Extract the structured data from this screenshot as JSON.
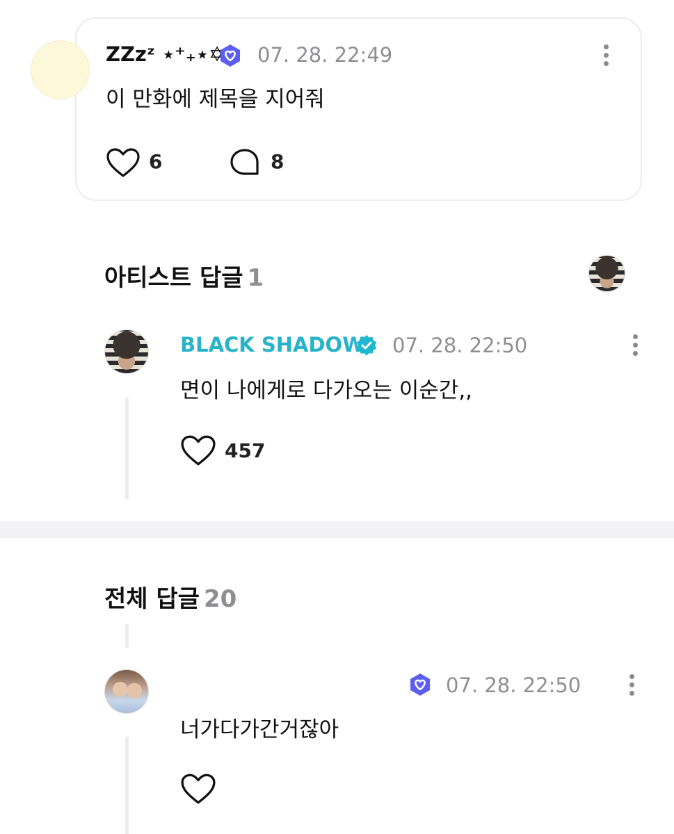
{
  "post": {
    "author": "ZZzᶻ ⋆⁺₊⋆✡.",
    "timestamp": "07. 28. 22:49",
    "text": "이 만화에 제목을 지어줘",
    "likes": "6",
    "comments": "8"
  },
  "artist_replies": {
    "title": "아티스트 답글",
    "count": "1",
    "items": [
      {
        "author": "BLACK SHADOW",
        "timestamp": "07. 28. 22:50",
        "text": "면이 나에게로 다가오는 이순간,,",
        "likes": "457"
      }
    ]
  },
  "all_replies": {
    "title": "전체 답글",
    "count": "20",
    "items": [
      {
        "author": "",
        "timestamp": "07. 28. 22:50",
        "text": "너가다가간거잖아",
        "likes": ""
      }
    ]
  },
  "colors": {
    "artist_name": "#27b3c9",
    "badge_purple": "#5b5ef0",
    "badge_cyan": "#1fb8cf",
    "muted": "#8e8e93"
  },
  "icons": [
    "heart-icon",
    "comment-bubble-icon",
    "more-options-icon",
    "membership-badge-icon",
    "verified-badge-icon"
  ]
}
